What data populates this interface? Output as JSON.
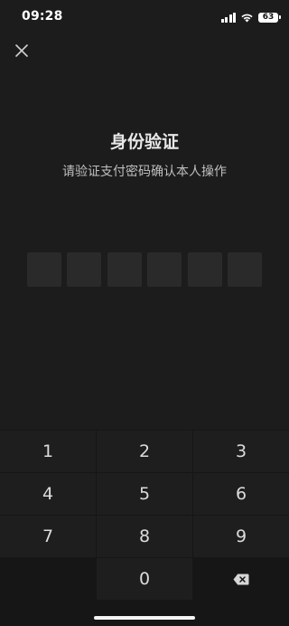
{
  "status_bar": {
    "time": "09:28",
    "battery": "63",
    "icons": [
      "signal-icon",
      "wifi-icon",
      "battery-icon"
    ]
  },
  "header": {
    "close_icon": "close-icon",
    "title": "身份验证",
    "subtitle": "请验证支付密码确认本人操作"
  },
  "pin": {
    "length": 6,
    "entered": 0
  },
  "keypad": {
    "rows": [
      [
        "1",
        "2",
        "3"
      ],
      [
        "4",
        "5",
        "6"
      ],
      [
        "7",
        "8",
        "9"
      ],
      [
        "",
        "0",
        "backspace-icon"
      ]
    ]
  },
  "colors": {
    "background": "#1c1c1c",
    "pin_box": "#2a2a2a",
    "key": "#1e1e1e",
    "keypad_bg": "#161616"
  }
}
